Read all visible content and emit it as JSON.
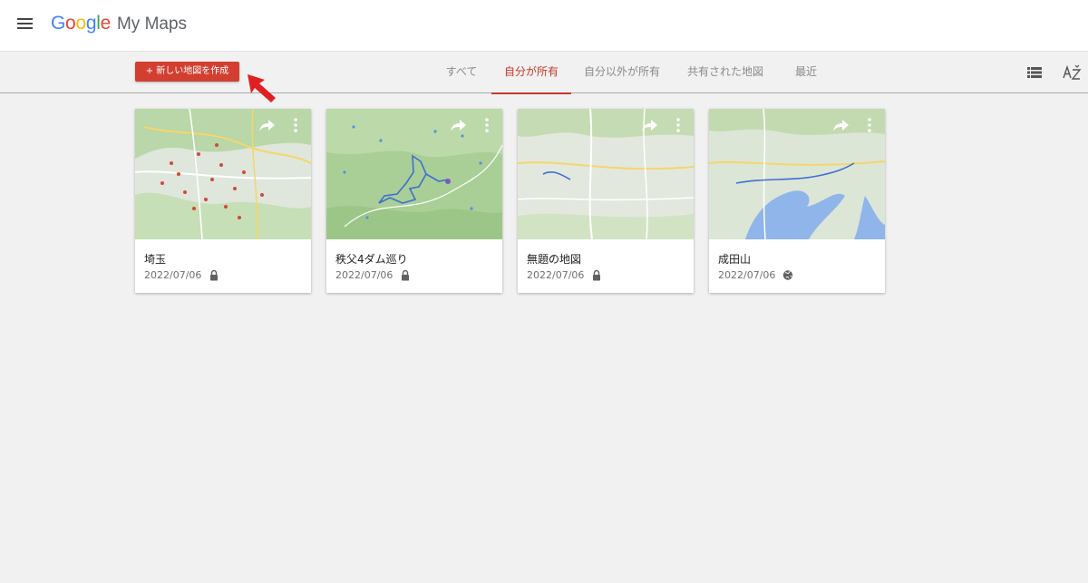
{
  "header": {
    "menu_icon": "hamburger-menu-icon",
    "logo_letters": [
      {
        "ch": "G",
        "color": "#4285F4"
      },
      {
        "ch": "o",
        "color": "#EA4335"
      },
      {
        "ch": "o",
        "color": "#FBBC05"
      },
      {
        "ch": "g",
        "color": "#4285F4"
      },
      {
        "ch": "l",
        "color": "#34A853"
      },
      {
        "ch": "e",
        "color": "#EA4335"
      }
    ],
    "product": "My Maps"
  },
  "toolbar": {
    "create_label": "+ 新しい地図を作成",
    "create_color": "#d23f31",
    "tabs": [
      {
        "label": "すべて",
        "active": false
      },
      {
        "label": "自分が所有",
        "active": true
      },
      {
        "label": "自分以外が所有",
        "active": false
      },
      {
        "label": "共有された地図",
        "active": false
      },
      {
        "label": "最近",
        "active": false
      }
    ],
    "active_color": "#c53929",
    "view_icon": "list-view-icon",
    "sort_icon": "sort-az-icon"
  },
  "annotation": {
    "icon": "red-pointer-arrow-icon",
    "color": "#e02020"
  },
  "maps": [
    {
      "title": "埼玉",
      "date": "2022/07/06",
      "visibility": "private",
      "visibility_icon": "lock-icon"
    },
    {
      "title": "秩父4ダム巡り",
      "date": "2022/07/06",
      "visibility": "private",
      "visibility_icon": "lock-icon"
    },
    {
      "title": "無題の地図",
      "date": "2022/07/06",
      "visibility": "private",
      "visibility_icon": "lock-icon"
    },
    {
      "title": "成田山",
      "date": "2022/07/06",
      "visibility": "public",
      "visibility_icon": "globe-icon"
    }
  ]
}
